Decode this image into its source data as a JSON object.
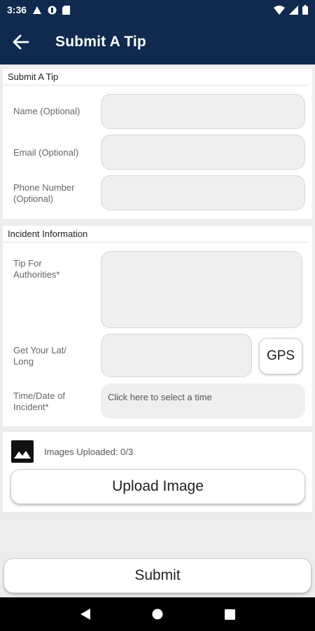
{
  "status_bar": {
    "time": "3:36"
  },
  "app_bar": {
    "title": "Submit A Tip"
  },
  "tip_section": {
    "header": "Submit A Tip",
    "name_label": "Name (Optional)",
    "email_label": "Email (Optional)",
    "phone_label_line1": "Phone Number",
    "phone_label_line2": "(Optional)"
  },
  "incident_section": {
    "header": "Incident Information",
    "tip_label_line1": "Tip For",
    "tip_label_line2": "Authorities*",
    "latlong_label_line1": "Get Your Lat/",
    "latlong_label_line2": "Long",
    "gps_button": "GPS",
    "time_label_line1": "Time/Date of",
    "time_label_line2": "Incident*",
    "time_placeholder": "Click here to select a time"
  },
  "images_section": {
    "uploaded_text": "Images Uploaded: 0/3",
    "upload_button": "Upload Image"
  },
  "submit_button": "Submit",
  "colors": {
    "app_bar": "#0f2a4e",
    "background": "#ededed"
  }
}
